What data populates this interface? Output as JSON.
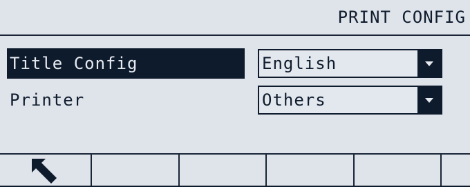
{
  "header": {
    "title": "PRINT CONFIG"
  },
  "rows": [
    {
      "label": "Title Config",
      "value": "English",
      "selected": true
    },
    {
      "label": "Printer",
      "value": "Others",
      "selected": false
    }
  ],
  "softkeys": [
    {
      "icon": "back-arrow-icon"
    },
    {
      "icon": ""
    },
    {
      "icon": ""
    },
    {
      "icon": ""
    },
    {
      "icon": ""
    },
    {
      "icon": ""
    }
  ],
  "colors": {
    "background": "#dfe3ea",
    "foreground": "#0e1b2c",
    "selected_text": "#e6eaf0"
  }
}
